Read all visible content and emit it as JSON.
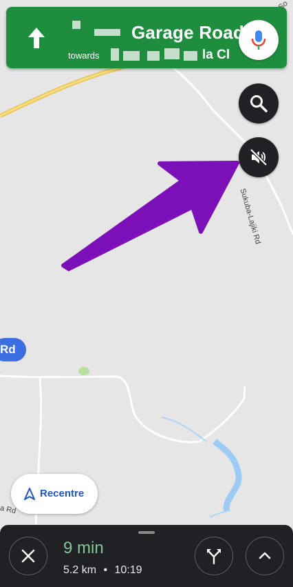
{
  "navigation": {
    "direction_icon": "arrow-up-icon",
    "street_name": "Garage Road",
    "towards_label": "towards",
    "towards_suffix": "la Cl",
    "mic_icon": "microphone-icon",
    "banner_color": "#1e8e3e"
  },
  "map": {
    "road_badge": "Rd",
    "road_label_right": "Sukuba-Lajiki Rd",
    "road_label_corner": "So",
    "road_label_left": "a Rd",
    "search_icon": "search-icon",
    "mute_icon": "volume-off-icon",
    "annotation": "purple-arrow",
    "annotation_color": "#7b0fb8"
  },
  "recentre": {
    "label": "Recentre",
    "icon": "navigation-arrow-icon"
  },
  "trip": {
    "time": "9 min",
    "distance": "5.2 km",
    "separator": "•",
    "arrival": "10:19",
    "close_icon": "close-icon",
    "alt_routes_icon": "fork-route-icon",
    "expand_icon": "chevron-up-icon"
  }
}
